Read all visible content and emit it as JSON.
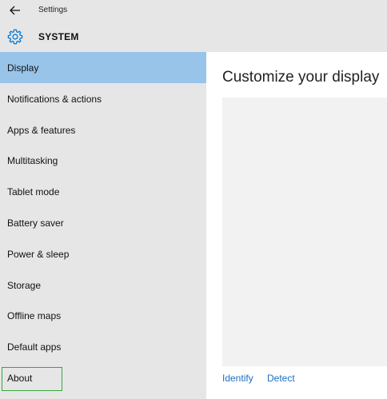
{
  "window": {
    "title": "Settings"
  },
  "header": {
    "title": "SYSTEM",
    "icon": "gear-icon"
  },
  "sidebar": {
    "items": [
      {
        "label": "Display",
        "selected": true
      },
      {
        "label": "Notifications & actions"
      },
      {
        "label": "Apps & features"
      },
      {
        "label": "Multitasking"
      },
      {
        "label": "Tablet mode"
      },
      {
        "label": "Battery saver"
      },
      {
        "label": "Power & sleep"
      },
      {
        "label": "Storage"
      },
      {
        "label": "Offline maps"
      },
      {
        "label": "Default apps"
      },
      {
        "label": "About",
        "focused": true
      }
    ]
  },
  "main": {
    "title": "Customize your display",
    "identify_label": "Identify",
    "detect_label": "Detect"
  },
  "colors": {
    "selected_bg": "#98c4ea",
    "sidebar_bg": "#e6e6e6",
    "link": "#1a6fc4",
    "accent": "#0078d7",
    "focus_outline": "#3aa640"
  }
}
